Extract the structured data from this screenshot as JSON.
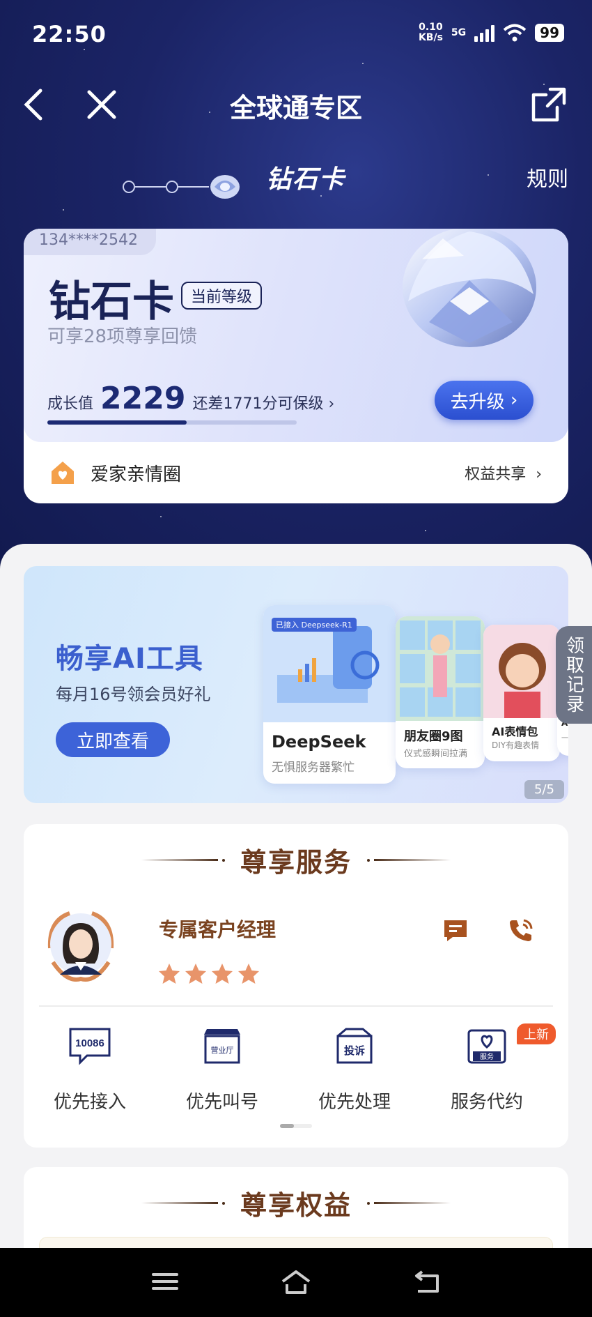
{
  "status": {
    "time": "22:50",
    "speed": "0.10",
    "speed_unit": "KB/s",
    "network": "5G",
    "battery": "99"
  },
  "header": {
    "title": "全球通专区",
    "level_name": "钻石卡",
    "rules": "规则"
  },
  "card": {
    "phone": "134****2542",
    "level": "钻石卡",
    "current_tag": "当前等级",
    "subtitle": "可享28项尊享回馈",
    "growth_label": "成长值",
    "growth_value": "2229",
    "growth_hint": "还差1771分可保级",
    "progress_fraction": 0.56,
    "upgrade_button": "去升级",
    "family_label": "爱家亲情圈",
    "share_link": "权益共享"
  },
  "banner": {
    "title": "畅享AI工具",
    "subtitle": "每月16号领会员好礼",
    "button": "立即查看",
    "counter": "5/5",
    "cards": [
      {
        "tag": "已接入 Deepseek-R1",
        "title": "DeepSeek",
        "sub": "无惧服务器繁忙"
      },
      {
        "title": "朋友圈9图",
        "sub": "仪式感瞬间拉满"
      },
      {
        "title": "AI表情包",
        "sub": "DIY有趣表情"
      },
      {
        "title": "AI",
        "sub": "一键"
      }
    ]
  },
  "side_tab": "领取记录",
  "services": {
    "title": "尊享服务",
    "manager_title": "专属客户经理",
    "stars": 4,
    "items": [
      {
        "label": "优先接入",
        "icon_text": "10086"
      },
      {
        "label": "优先叫号",
        "icon_text": "营业厅"
      },
      {
        "label": "优先处理",
        "icon_text": "投诉"
      },
      {
        "label": "服务代约",
        "icon_text": "服务"
      }
    ],
    "new_badge": "上新"
  },
  "benefits": {
    "title": "尊享权益"
  },
  "colors": {
    "accent": "#3d63d8",
    "brown": "#6b3a1e",
    "navy": "#1b2466"
  }
}
